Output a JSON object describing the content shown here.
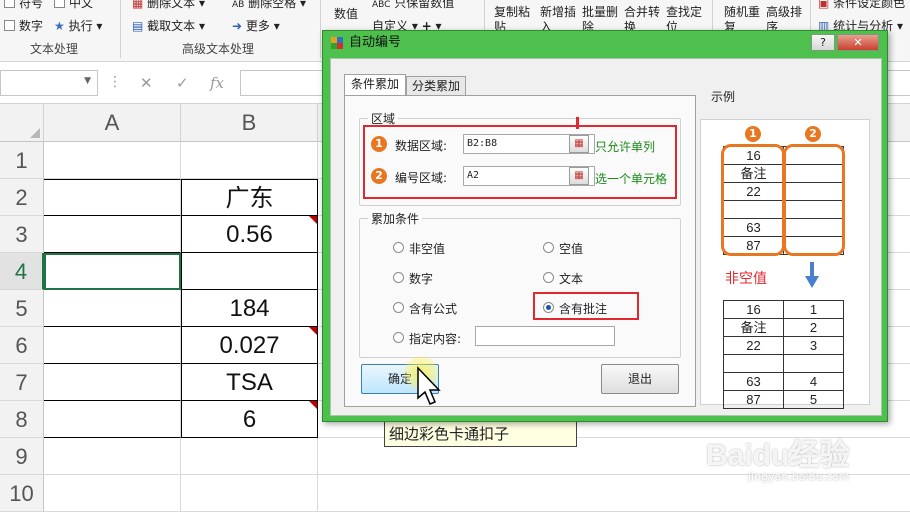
{
  "ribbon": {
    "items": [
      {
        "label": "符号"
      },
      {
        "label": "中文"
      },
      {
        "label": "数字"
      },
      {
        "label": "执行"
      },
      {
        "label": "删除文本"
      },
      {
        "label": "截取文本"
      },
      {
        "label": "删除空格"
      },
      {
        "label": "更多"
      },
      {
        "label": "数值"
      },
      {
        "label": "只保留数值"
      },
      {
        "label": "自定义"
      },
      {
        "label": "复制粘贴"
      },
      {
        "label": "新增插入"
      },
      {
        "label": "批量删除"
      },
      {
        "label": "合并转换"
      },
      {
        "label": "查找定位"
      },
      {
        "label": "随机重复"
      },
      {
        "label": "高级排序"
      },
      {
        "label": "条件设定颜色"
      },
      {
        "label": "统计与分析"
      }
    ],
    "groups": [
      "文本处理",
      "高级文本处理"
    ]
  },
  "formula_bar": {
    "fx": "fx",
    "cancel": "✕",
    "confirm": "✓"
  },
  "sheet": {
    "columns": [
      "A",
      "B"
    ],
    "rows": [
      {
        "num": "1",
        "b": ""
      },
      {
        "num": "2",
        "b": "广东"
      },
      {
        "num": "3",
        "b": "0.56"
      },
      {
        "num": "4",
        "b": ""
      },
      {
        "num": "5",
        "b": "184"
      },
      {
        "num": "6",
        "b": "0.027"
      },
      {
        "num": "7",
        "b": "TSA"
      },
      {
        "num": "8",
        "b": "6"
      },
      {
        "num": "9",
        "b": ""
      },
      {
        "num": "10",
        "b": ""
      }
    ],
    "active_row": "4"
  },
  "dialog": {
    "title": "自动编号",
    "help": "?",
    "close": "✕",
    "tabs": [
      "条件累加",
      "分类累加"
    ],
    "region": {
      "title": "区域",
      "data_label": "数据区域:",
      "data_value": "B2:B8",
      "data_hint": "只允许单列",
      "num_label": "编号区域:",
      "num_value": "A2",
      "num_hint": "选一个单元格"
    },
    "conditions": {
      "title": "累加条件",
      "options": [
        "非空值",
        "空值",
        "数字",
        "文本",
        "含有公式",
        "含有批注",
        "指定内容:"
      ],
      "selected": "含有批注"
    },
    "ok": "确定",
    "exit": "退出",
    "example": {
      "title": "示例",
      "badge1": "1",
      "badge2": "2",
      "top_rows": [
        [
          "16",
          ""
        ],
        [
          "备注",
          ""
        ],
        [
          "22",
          ""
        ],
        [
          "",
          ""
        ],
        [
          "63",
          ""
        ],
        [
          "87",
          ""
        ]
      ],
      "arrow_label": "非空值",
      "bottom_rows": [
        [
          "16",
          "1"
        ],
        [
          "备注",
          "2"
        ],
        [
          "22",
          "3"
        ],
        [
          "",
          ""
        ],
        [
          "63",
          "4"
        ],
        [
          "87",
          "5"
        ]
      ]
    }
  },
  "tooltip": "细边彩色卡通扣子",
  "watermark": {
    "main": "Baidu经验",
    "sub": "jingyan.baidu.com"
  },
  "colors": {
    "dialog_frame": "#4ec04e",
    "accent_orange": "#e87722",
    "highlight_red": "#e0282e",
    "hint_green": "#1a8a1a",
    "excel_green": "#217346"
  }
}
